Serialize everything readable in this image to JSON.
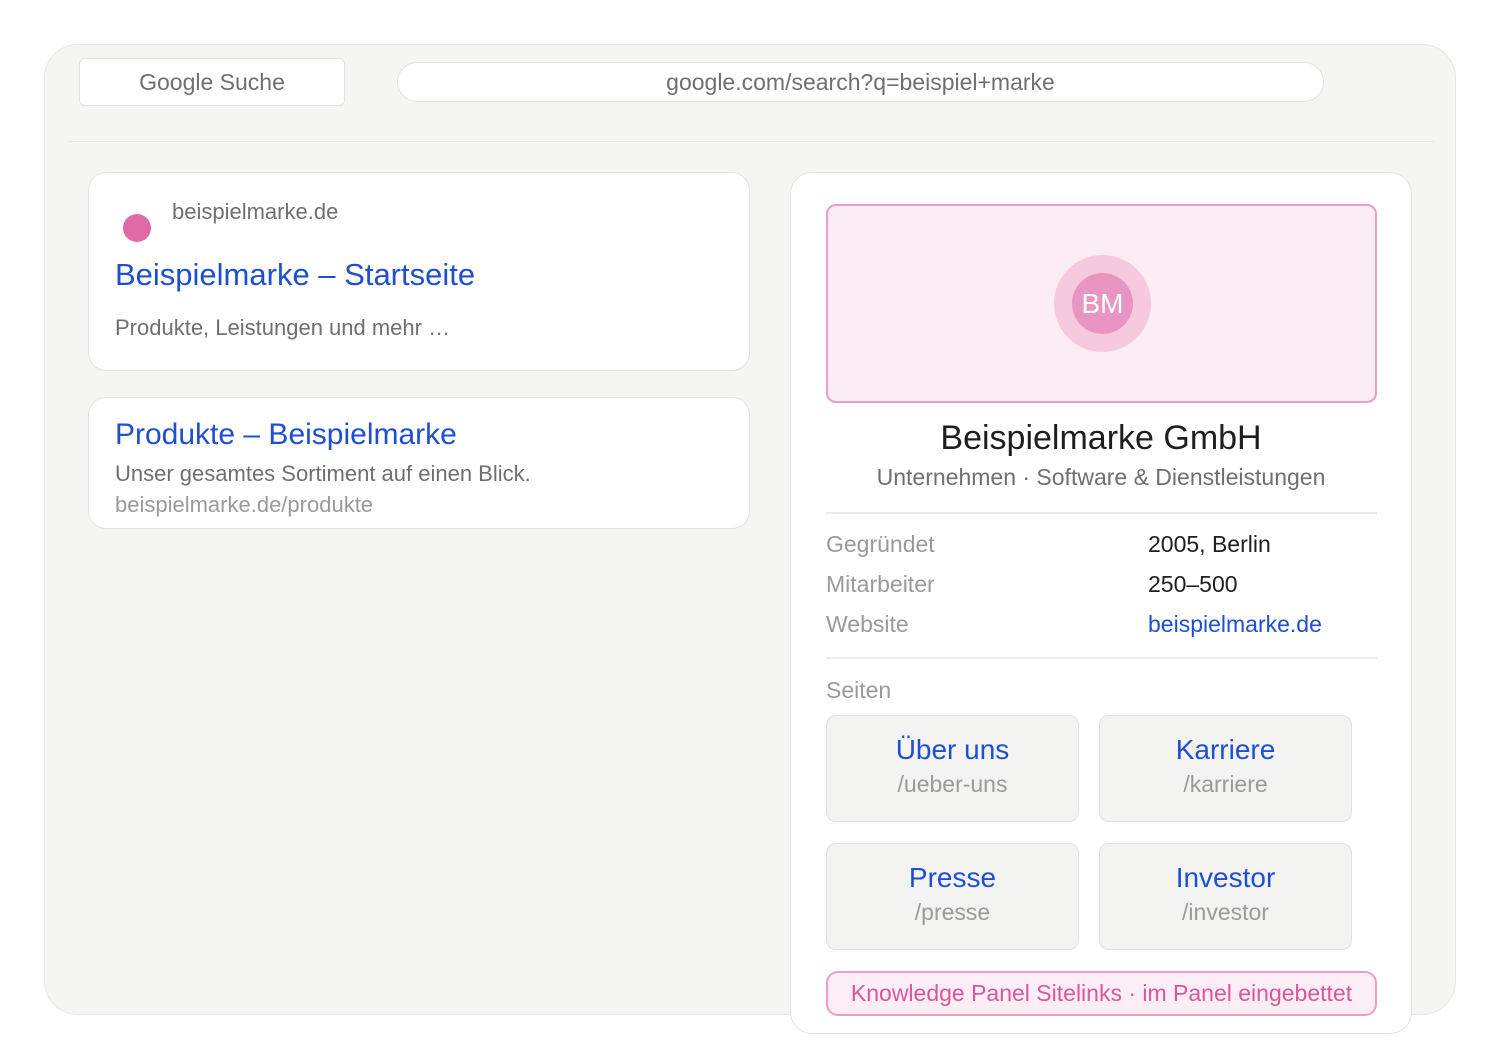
{
  "browser": {
    "tab_title": "Google Suche",
    "url": "google.com/search?q=beispiel+marke"
  },
  "results": [
    {
      "domain": "beispielmarke.de",
      "title": "Beispielmarke – Startseite",
      "snippet": "Produkte, Leistungen und mehr …",
      "favicon_color": "#e06aa6"
    },
    {
      "title": "Produkte – Beispielmarke",
      "snippet": "Unser gesamtes Sortiment auf einen Blick.",
      "path": "beispielmarke.de/produkte"
    }
  ],
  "panel": {
    "logo_initials": "BM",
    "name": "Beispielmarke GmbH",
    "subtitle": "Unternehmen · Software & Dienstleistungen",
    "facts": [
      {
        "label": "Gegründet",
        "value": "2005, Berlin"
      },
      {
        "label": "Mitarbeiter",
        "value": "250–500"
      },
      {
        "label": "Website",
        "value": "beispielmarke.de"
      }
    ],
    "sitelinks_heading": "Seiten",
    "sitelinks": [
      {
        "title": "Über uns",
        "path": "/ueber-uns"
      },
      {
        "title": "Karriere",
        "path": "/karriere"
      },
      {
        "title": "Presse",
        "path": "/presse"
      },
      {
        "title": "Investor",
        "path": "/investor"
      }
    ],
    "badge": "Knowledge Panel Sitelinks · im Panel eingebettet"
  },
  "colors": {
    "link": "#1f4fd1",
    "accent_pink": "#e06aa6",
    "frame_bg": "#f5f5f3"
  }
}
